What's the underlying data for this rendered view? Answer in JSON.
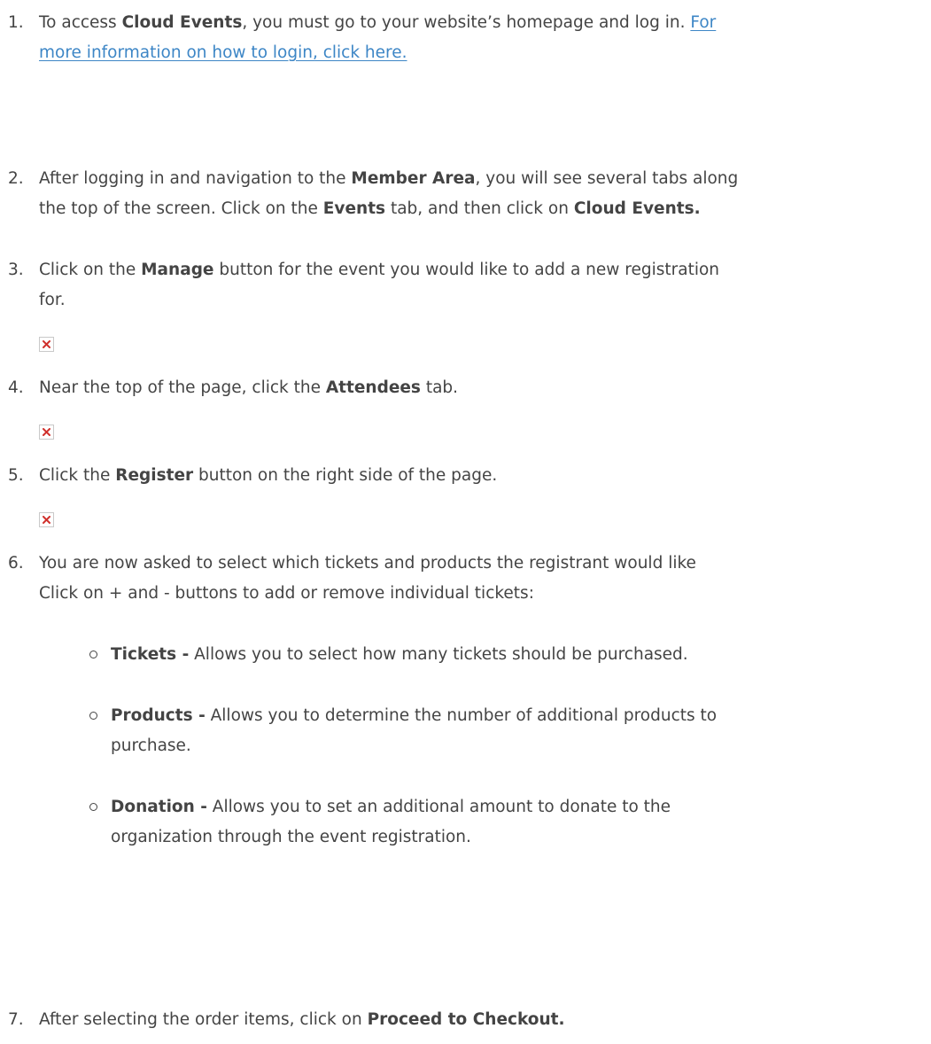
{
  "steps": [
    {
      "num": "1.",
      "pre": "To access ",
      "bold": "Cloud Events",
      "post": ", you must go to your website’s homepage and log in. ",
      "link_line1": "For",
      "link_line2": "more information on how to login, click here."
    },
    {
      "num": "2.",
      "l1_pre": "After logging in and navigation to the ",
      "l1_bold": "Member Area",
      "l1_post": ", you will see several tabs along",
      "l2_pre": "the top of the screen. Click on the ",
      "l2_bold1": "Events",
      "l2_mid": " tab, and then click on ",
      "l2_bold2": "Cloud Events."
    },
    {
      "num": "3.",
      "l1_pre": "Click on the ",
      "l1_bold": "Manage",
      "l1_post": " button for the event you would like to add a new registration",
      "l2": "for."
    },
    {
      "num": "4.",
      "pre": "Near the top of the page, click the ",
      "bold": "Attendees",
      "post": " tab."
    },
    {
      "num": "5.",
      "pre": "Click the ",
      "bold": "Register",
      "post": " button on the right side of the page."
    },
    {
      "num": "6.",
      "l1": "You are now asked to select which tickets and products the registrant would like",
      "l2": "Click on + and - buttons to add or remove individual tickets:"
    },
    {
      "num": "7.",
      "pre": "After selecting the order items, click on ",
      "bold": "Proceed to Checkout."
    }
  ],
  "sub_items": [
    {
      "bold": "Tickets -",
      "l1": " Allows you to select how many tickets should be purchased."
    },
    {
      "bold": "Products -",
      "l1": " Allows you to determine the number of additional products to",
      "l2": "purchase."
    },
    {
      "bold": "Donation -",
      "l1": " Allows you to set an additional amount to donate to the",
      "l2": "organization through the event registration."
    }
  ],
  "colors": {
    "text": "#444444",
    "link": "#3d86c6",
    "broken_image_x": "#d0312d"
  },
  "icons": {
    "broken_image": "broken-image-icon",
    "bullet": "hollow-circle-bullet"
  }
}
